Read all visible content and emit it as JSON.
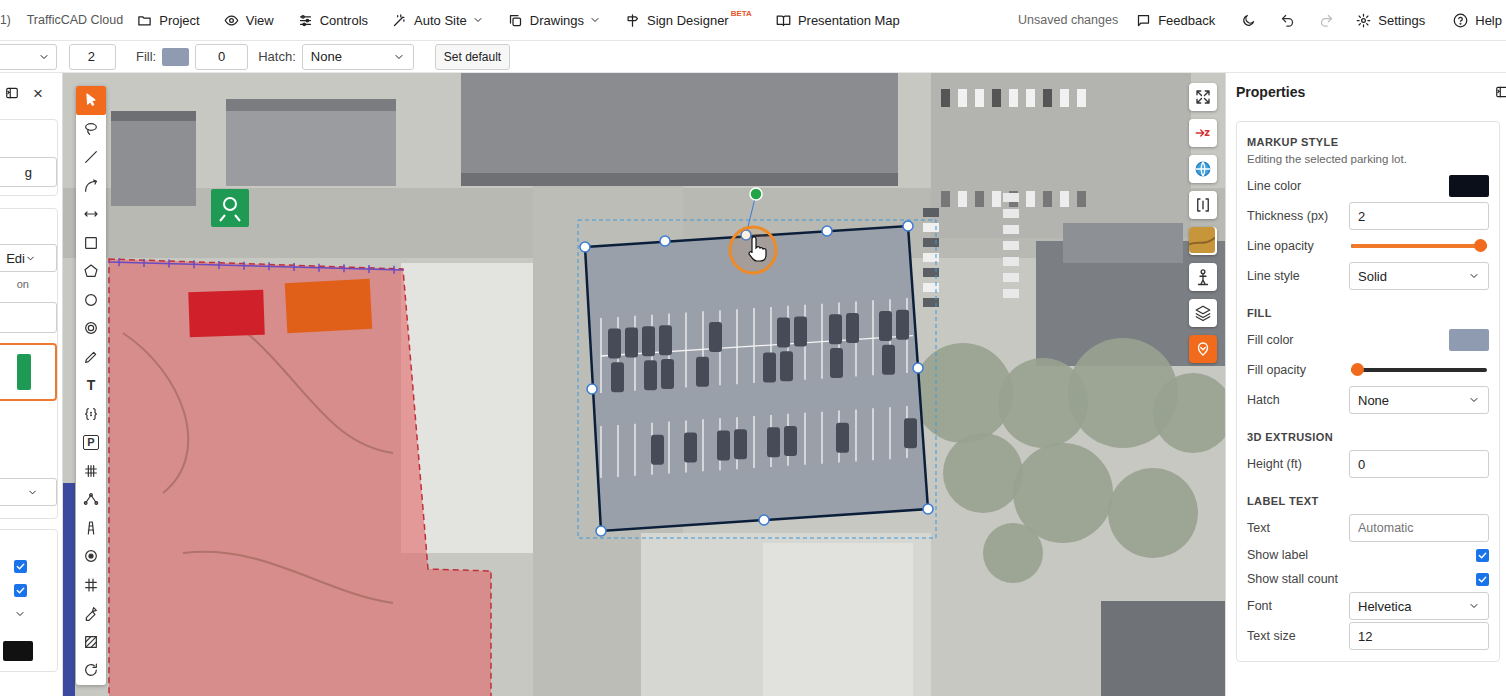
{
  "topbar": {
    "title_fragment": "1)",
    "app_name": "TrafficCAD Cloud",
    "menu": [
      {
        "label": "Project",
        "dropdown": false
      },
      {
        "label": "View",
        "dropdown": false
      },
      {
        "label": "Controls",
        "dropdown": false
      },
      {
        "label": "Auto Site",
        "dropdown": true
      },
      {
        "label": "Drawings",
        "dropdown": true
      },
      {
        "label": "Sign Designer",
        "dropdown": false,
        "badge": "BETA"
      },
      {
        "label": "Presentation Map",
        "dropdown": false
      }
    ],
    "status": "Unsaved changes",
    "feedback": "Feedback",
    "undo_disabled": false,
    "redo_disabled": true,
    "settings": "Settings",
    "help": "Help"
  },
  "style_bar": {
    "thickness": "2",
    "fill_label": "Fill:",
    "fill_color": "#8e9bb0",
    "fill_value": "0",
    "hatch_label": "Hatch:",
    "hatch_value": "None",
    "set_default": "Set default"
  },
  "left_panel": {
    "close": "×",
    "field_fragment": "g",
    "select_fragment": "Edi",
    "note_fragment": "on",
    "card_selected": true,
    "checks": [
      {
        "checked": true
      },
      {
        "checked": true
      }
    ]
  },
  "tools": [
    {
      "selected": true
    },
    {
      "selected": false
    },
    {
      "selected": false
    },
    {
      "selected": false
    },
    {
      "selected": false
    },
    {
      "selected": false
    },
    {
      "selected": false
    },
    {
      "selected": false
    },
    {
      "selected": false
    },
    {
      "selected": false
    },
    {
      "selected": false,
      "glyph": "T"
    },
    {
      "selected": false
    },
    {
      "selected": false,
      "glyph": "P"
    },
    {
      "selected": false
    },
    {
      "selected": false
    },
    {
      "selected": false
    },
    {
      "selected": false
    },
    {
      "selected": false
    },
    {
      "selected": false
    },
    {
      "selected": false
    },
    {
      "selected": false
    }
  ],
  "map_controls": [
    {
      "selected": false
    },
    {
      "selected": false
    },
    {
      "selected": false
    },
    {
      "selected": false
    },
    {
      "selected": false
    },
    {
      "selected": false
    },
    {
      "selected": false
    },
    {
      "selected": true
    }
  ],
  "properties": {
    "title": "Properties",
    "sections": [
      {
        "title": "MARKUP STYLE",
        "note": "Editing the selected parking lot.",
        "rows": [
          {
            "kind": "color",
            "label": "Line color",
            "color": "#0b0f1a"
          },
          {
            "kind": "input",
            "label": "Thickness (px)",
            "value": "2"
          },
          {
            "kind": "slider",
            "label": "Line opacity",
            "level": 1
          },
          {
            "kind": "select",
            "label": "Line style",
            "value": "Solid"
          }
        ]
      },
      {
        "title": "FILL",
        "rows": [
          {
            "kind": "color",
            "label": "Fill color",
            "color": "#8e9bb0"
          },
          {
            "kind": "slider",
            "label": "Fill opacity",
            "level": 0
          },
          {
            "kind": "select",
            "label": "Hatch",
            "value": "None"
          }
        ]
      },
      {
        "title": "3D EXTRUSION",
        "rows": [
          {
            "kind": "input",
            "label": "Height (ft)",
            "value": "0"
          }
        ]
      },
      {
        "title": "LABEL TEXT",
        "rows": [
          {
            "kind": "placeholder",
            "label": "Text",
            "placeholder": "Automatic"
          },
          {
            "kind": "checkbox",
            "label": "Show label",
            "checked": true
          },
          {
            "kind": "checkbox",
            "label": "Show stall count",
            "checked": true
          },
          {
            "kind": "select",
            "label": "Font",
            "value": "Helvetica"
          },
          {
            "kind": "input",
            "label": "Text size",
            "value": "12"
          }
        ]
      }
    ]
  }
}
